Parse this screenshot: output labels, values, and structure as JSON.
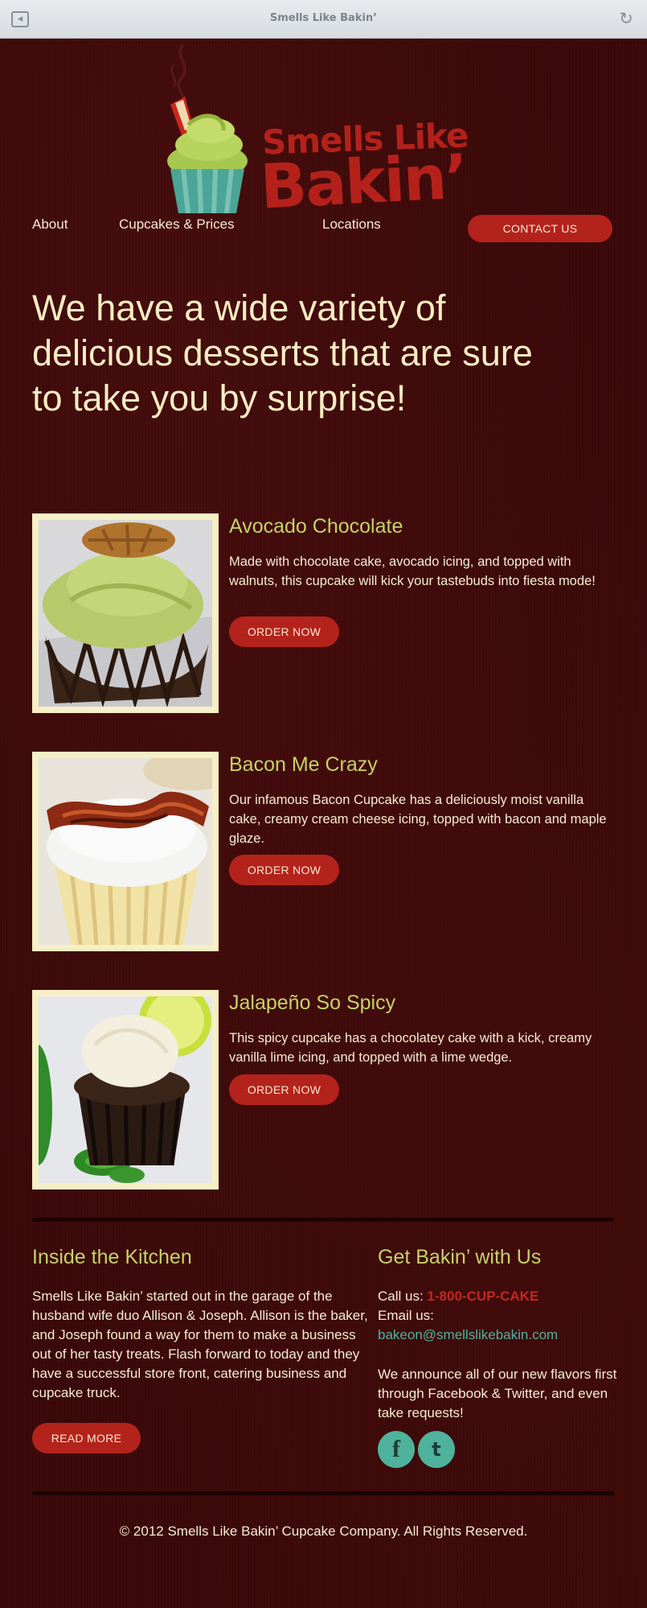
{
  "browser": {
    "title": "Smells Like Bakin’"
  },
  "logo": {
    "line1": "Smells Like",
    "line2": "Bakin’"
  },
  "nav": {
    "items": [
      "About",
      "Cupcakes & Prices",
      "Locations"
    ],
    "contact_label": "CONTACT US"
  },
  "hero": {
    "line1": "We have a wide variety of",
    "line2": "delicious desserts that are sure",
    "line3": "to take you by surprise!"
  },
  "products": [
    {
      "name": "Avocado Chocolate",
      "description": "Made with chocolate cake, avocado icing, and topped with walnuts, this cupcake will kick your tastebuds into fiesta mode!",
      "button": "ORDER NOW"
    },
    {
      "name": "Bacon Me Crazy",
      "description": "Our infamous Bacon Cupcake has a deliciously moist vanilla cake, creamy cream cheese icing, topped with bacon and maple glaze.",
      "button": "ORDER NOW"
    },
    {
      "name": "Jalapeño So Spicy",
      "description": "This spicy cupcake has a chocolatey cake with a kick, creamy vanilla lime icing, and topped with a lime wedge.",
      "button": "ORDER NOW"
    }
  ],
  "kitchen": {
    "title": "Inside the Kitchen",
    "text": "Smells Like Bakin’ started out in the garage of the husband wife duo Allison & Joseph. Allison is the baker, and Joseph found a way for them to make a business out of her tasty treats. Flash forward to today and they have a successful store front, catering business and cupcake truck.",
    "button": "READ MORE"
  },
  "contact": {
    "title": "Get Bakin’ with Us",
    "call_label": "Call us:",
    "phone": "1-800-CUP-CAKE",
    "email_label": "Email us:",
    "email": "bakeon@smellslikebakin.com",
    "announce": "We announce all of our new flavors first through Facebook & Twitter, and even take requests!",
    "facebook_glyph": "f",
    "twitter_glyph": "t"
  },
  "footer": {
    "text": "© 2012 Smells Like Bakin’ Cupcake Company. All Rights Reserved."
  },
  "colors": {
    "background": "#3b0808",
    "accent_red": "#b3231c",
    "title_green": "#c4d26a",
    "hero_cream": "#f6ecc3",
    "link_teal": "#4fb3a0"
  }
}
